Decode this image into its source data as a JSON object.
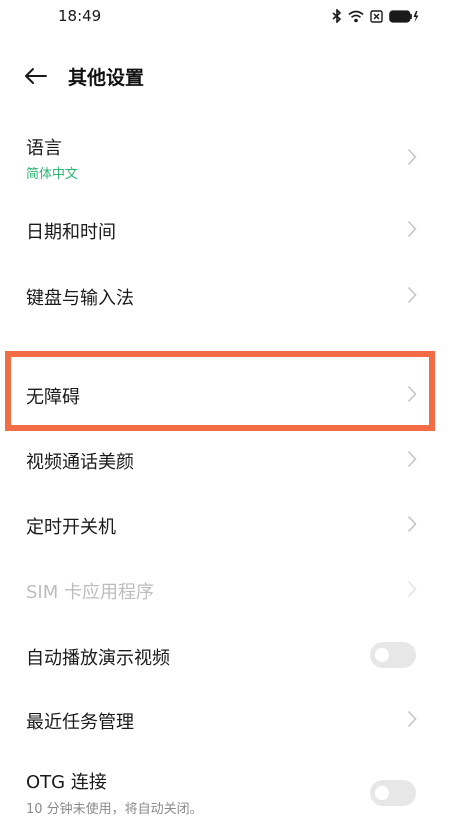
{
  "status_bar": {
    "time": "18:49",
    "icons": [
      "bluetooth-icon",
      "wifi-icon",
      "sim-x-icon",
      "battery-charging-icon"
    ]
  },
  "header": {
    "back_icon": "arrow-left-icon",
    "title": "其他设置"
  },
  "items": [
    {
      "label": "语言",
      "sub": "简体中文",
      "sub_color": "#2bb673",
      "control": "chevron"
    },
    {
      "label": "日期和时间",
      "control": "chevron"
    },
    {
      "label": "键盘与输入法",
      "control": "chevron"
    },
    {
      "label": "无障碍",
      "control": "chevron",
      "highlighted": true
    },
    {
      "label": "视频通话美颜",
      "control": "chevron"
    },
    {
      "label": "定时开关机",
      "control": "chevron"
    },
    {
      "label": "SIM 卡应用程序",
      "control": "chevron",
      "disabled": true
    },
    {
      "label": "自动播放演示视频",
      "control": "toggle",
      "on": false
    },
    {
      "label": "最近任务管理",
      "control": "chevron"
    },
    {
      "label": "OTG 连接",
      "sub": "10 分钟未使用，将自动关闭。",
      "sub_color": "#8a8a8a",
      "control": "toggle",
      "on": false
    }
  ],
  "colors": {
    "highlight": "#f26d45",
    "accent_green": "#2bb673"
  }
}
